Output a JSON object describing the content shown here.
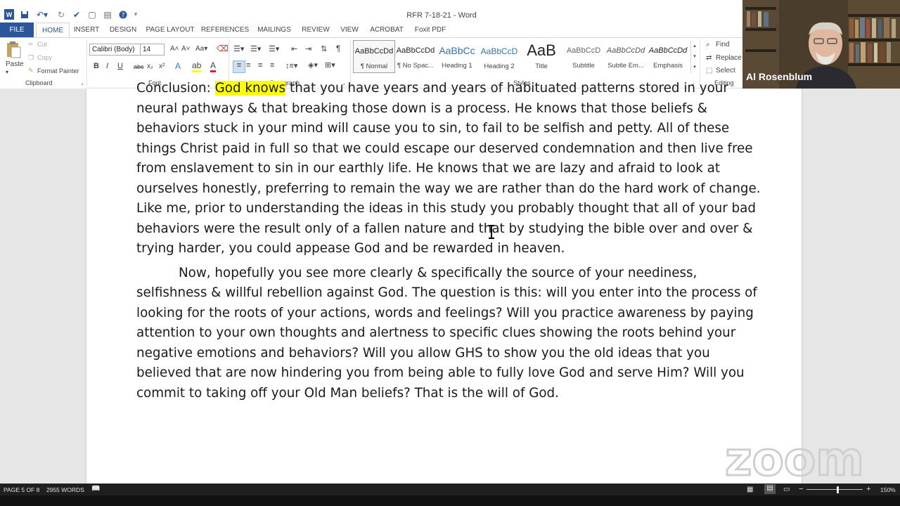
{
  "window": {
    "title": "RFR 7-18-21 - Word"
  },
  "tabs": [
    "FILE",
    "HOME",
    "INSERT",
    "DESIGN",
    "PAGE LAYOUT",
    "REFERENCES",
    "MAILINGS",
    "REVIEW",
    "VIEW",
    "ACROBAT",
    "Foxit PDF"
  ],
  "clipboard": {
    "paste": "Paste",
    "cut": "Cut",
    "copy": "Copy",
    "format_painter": "Format Painter",
    "label": "Clipboard"
  },
  "font": {
    "name": "Calibri (Body)",
    "size": "14",
    "label": "Font",
    "bold": "B",
    "italic": "I",
    "underline": "U",
    "strike": "abc",
    "sub": "x₂",
    "sup": "x²"
  },
  "paragraph": {
    "label": "Paragraph"
  },
  "styles": {
    "label": "Styles",
    "items": [
      {
        "sample": "AaBbCcDd",
        "name": "¶ Normal"
      },
      {
        "sample": "AaBbCcDd",
        "name": "¶ No Spac..."
      },
      {
        "sample": "AaBbCc",
        "name": "Heading 1"
      },
      {
        "sample": "AaBbCcD",
        "name": "Heading 2"
      },
      {
        "sample": "AaB",
        "name": "Title"
      },
      {
        "sample": "AaBbCcD",
        "name": "Subtitle"
      },
      {
        "sample": "AaBbCcDd",
        "name": "Subtle Em..."
      },
      {
        "sample": "AaBbCcDd",
        "name": "Emphasis"
      }
    ]
  },
  "editing": {
    "find": "Find",
    "replace": "Replace",
    "select": "Select",
    "label": "Editing"
  },
  "document": {
    "line0_pre": "Conclusion: ",
    "line0_hl": "God knows",
    "line0_post": " that you have years and years of habituated patterns stored in your",
    "para1": "neural pathways & that breaking those down is a process. He knows that those beliefs & behaviors stuck in your mind will cause you to sin, to fail to be selfish and petty. All of these things Christ paid in full so that we could escape our deserved condemnation and then live free from enslavement to sin in our earthly life. He knows that we are lazy and afraid to look at ourselves honestly, preferring to remain the way we are rather than do the hard work of change. Like me, prior to understanding the ideas in this study you probably thought that all of your bad behaviors were the result only of a fallen nature and that by studying the bible over and over & trying harder, you could appease God and be rewarded in heaven.",
    "para2": "Now, hopefully you see more clearly & specifically the source of your neediness, selfishness & willful rebellion against God. The question is this: will you enter into the process of looking for the roots of your actions, words and feelings? Will you practice awareness by paying attention to your own thoughts and alertness to specific clues showing the roots behind your negative emotions and behaviors? Will you allow GHS to show you the old ideas that you believed that are now hindering you from being able to fully love God and serve Him? Will you commit to taking off your Old Man beliefs?  That is the will of God."
  },
  "status": {
    "page": "PAGE 5 OF 8",
    "words": "2955 WORDS",
    "zoom": "150%"
  },
  "video": {
    "participant": "Al Rosenblum"
  },
  "watermark": "zoom"
}
